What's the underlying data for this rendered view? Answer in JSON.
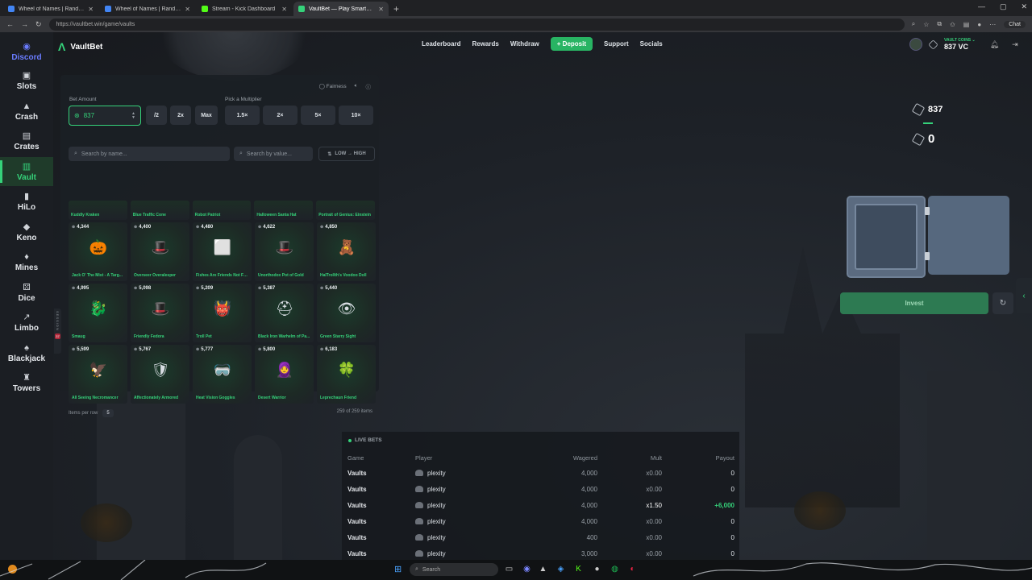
{
  "browser": {
    "tabs": [
      {
        "title": "Wheel of Names | Random name pi...",
        "color": "#4285f4"
      },
      {
        "title": "Wheel of Names | Random name pi...",
        "color": "#4285f4"
      },
      {
        "title": "Stream - Kick Dashboard",
        "color": "#53fc18"
      },
      {
        "title": "VaultBet — Play Smarter, Bet Fairer",
        "color": "#35d27a"
      }
    ],
    "new_tab": "+",
    "url": "https://vaultbet.win/game/vaults",
    "chat_label": "Chat",
    "win_min": "—",
    "win_max": "▢",
    "win_close": "✕"
  },
  "sidebar": {
    "items": [
      {
        "label": "Discord",
        "icon": "◉"
      },
      {
        "label": "Slots",
        "icon": "▣"
      },
      {
        "label": "Crash",
        "icon": "▲"
      },
      {
        "label": "Crates",
        "icon": "▤"
      },
      {
        "label": "Vault",
        "icon": "▥"
      },
      {
        "label": "HiLo",
        "icon": "▮"
      },
      {
        "label": "Keno",
        "icon": "◆"
      },
      {
        "label": "Mines",
        "icon": "♦"
      },
      {
        "label": "Dice",
        "icon": "⚄"
      },
      {
        "label": "Limbo",
        "icon": "↗"
      },
      {
        "label": "Blackjack",
        "icon": "♠"
      },
      {
        "label": "Towers",
        "icon": "♜"
      }
    ]
  },
  "header": {
    "logo": "VaultBet",
    "nav": [
      "Leaderboard",
      "Rewards",
      "Withdraw"
    ],
    "deposit": "+ Deposit",
    "nav2": [
      "Support",
      "Socials"
    ],
    "wallet_label": "VAULT COINS ⌄",
    "wallet_value": "837 VC"
  },
  "game": {
    "fairness": "Fairness",
    "bet_amount_label": "Bet Amount",
    "bet_amount_value": "837",
    "half": "/2",
    "double": "2x",
    "max": "Max",
    "multiplier_label": "Pick a Multiplier",
    "multipliers": [
      "1.5×",
      "2×",
      "5×",
      "10×"
    ],
    "search_name_placeholder": "Search by name...",
    "search_value_placeholder": "Search by value...",
    "sort_label": "LOW → HIGH",
    "top_row": [
      "Kuddly Kraken",
      "Blue Traffic Cone",
      "Robot Patriot",
      "Halloween Santa Hat",
      "Portrait of Genius: Einstein"
    ],
    "items": [
      {
        "price": "4,344",
        "name": "Jack O' The Mist - A Targ...",
        "icon": "🎃"
      },
      {
        "price": "4,400",
        "name": "Overseer Overalesper",
        "icon": "🎩"
      },
      {
        "price": "4,480",
        "name": "Fishes Are Friends Not Fo...",
        "icon": "⬜"
      },
      {
        "price": "4,622",
        "name": "Unorthodox Pot of Gold",
        "icon": "🎩"
      },
      {
        "price": "4,850",
        "name": "HalTrollth's Voodoo Doll",
        "icon": "🧸"
      },
      {
        "price": "4,995",
        "name": "Smaug",
        "icon": "🐉"
      },
      {
        "price": "5,098",
        "name": "Friendly Fedora",
        "icon": "🎩"
      },
      {
        "price": "5,209",
        "name": "Troll Pet",
        "icon": "👹"
      },
      {
        "price": "5,387",
        "name": "Black Iron Warhelm of Pa...",
        "icon": "⛑"
      },
      {
        "price": "5,440",
        "name": "Green Starry Sight",
        "icon": "👁"
      },
      {
        "price": "5,599",
        "name": "All Seeing Necromancer",
        "icon": "🦅"
      },
      {
        "price": "5,767",
        "name": "Affectionately Armored",
        "icon": "🛡"
      },
      {
        "price": "5,777",
        "name": "Heat Vision Goggles",
        "icon": "🥽"
      },
      {
        "price": "5,800",
        "name": "Desert Warrior",
        "icon": "🧕"
      },
      {
        "price": "6,183",
        "name": "Leprechaun Friend",
        "icon": "🍀"
      }
    ],
    "items_per_row_label": "Items per row",
    "items_per_row_value": "5",
    "count_text": "259 of 259 items",
    "session_label": "SESSION",
    "session_badge": "37"
  },
  "vault": {
    "balance": "837",
    "vc_value": "0",
    "invest": "Invest"
  },
  "live_bets": {
    "title": "LIVE BETS",
    "columns": [
      "Game",
      "Player",
      "Wagered",
      "Mult",
      "Payout"
    ],
    "rows": [
      {
        "game": "Vaults",
        "player": "plexity",
        "wagered": "4,000",
        "mult": "x0.00",
        "payout": "0"
      },
      {
        "game": "Vaults",
        "player": "plexity",
        "wagered": "4,000",
        "mult": "x0.00",
        "payout": "0"
      },
      {
        "game": "Vaults",
        "player": "plexity",
        "wagered": "4,000",
        "mult": "x1.50",
        "payout": "+6,000"
      },
      {
        "game": "Vaults",
        "player": "plexity",
        "wagered": "4,000",
        "mult": "x0.00",
        "payout": "0"
      },
      {
        "game": "Vaults",
        "player": "plexity",
        "wagered": "400",
        "mult": "x0.00",
        "payout": "0"
      },
      {
        "game": "Vaults",
        "player": "plexity",
        "wagered": "3,000",
        "mult": "x0.00",
        "payout": "0"
      }
    ]
  },
  "taskbar": {
    "search": "Search"
  },
  "colors": {
    "accent": "#35d27a",
    "deposit": "#28b463",
    "invest": "#2d7a52",
    "discord": "#6a7cff"
  }
}
